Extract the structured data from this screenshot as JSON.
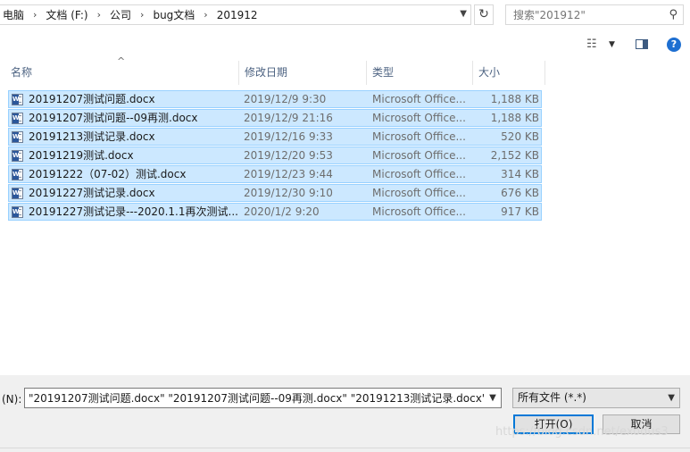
{
  "address_bar": {
    "breadcrumbs": [
      "电脑",
      "文档 (F:)",
      "公司",
      "bug文档",
      "201912"
    ],
    "separator": "›"
  },
  "search": {
    "placeholder": "搜索\"201912\""
  },
  "columns": {
    "name": "名称",
    "date": "修改日期",
    "type": "类型",
    "size": "大小"
  },
  "files": [
    {
      "name": "20191207测试问题.docx",
      "date": "2019/12/9 9:30",
      "type": "Microsoft Office...",
      "size": "1,188 KB"
    },
    {
      "name": "20191207测试问题--09再测.docx",
      "date": "2019/12/9 21:16",
      "type": "Microsoft Office...",
      "size": "1,188 KB"
    },
    {
      "name": "20191213测试记录.docx",
      "date": "2019/12/16 9:33",
      "type": "Microsoft Office...",
      "size": "520 KB"
    },
    {
      "name": "20191219测试.docx",
      "date": "2019/12/20 9:53",
      "type": "Microsoft Office...",
      "size": "2,152 KB"
    },
    {
      "name": "20191222（07-02）测试.docx",
      "date": "2019/12/23 9:44",
      "type": "Microsoft Office...",
      "size": "314 KB"
    },
    {
      "name": "20191227测试记录.docx",
      "date": "2019/12/30 9:10",
      "type": "Microsoft Office...",
      "size": "676 KB"
    },
    {
      "name": "20191227测试记录---2020.1.1再次测试...",
      "date": "2020/1/2 9:20",
      "type": "Microsoft Office...",
      "size": "917 KB"
    }
  ],
  "bottom": {
    "filename_label": "(N):",
    "filename_value": "\"20191207测试问题.docx\" \"20191207测试问题--09再测.docx\" \"20191213测试记录.docx\" \"20191219测试.docx\"",
    "filter_label": "所有文件 (*.*)",
    "open_label": "打开(O)",
    "cancel_label": "取消"
  },
  "watermark": "https://blog.csdn.net/exodus3",
  "colors": {
    "selection": "#cce8ff",
    "selection_border": "#99d1ff",
    "accent": "#0078d7"
  },
  "icons": [
    "chevron-right-icon",
    "dropdown-arrow-icon",
    "refresh-icon",
    "search-icon",
    "view-options-icon",
    "preview-pane-icon",
    "help-icon",
    "word-document-icon",
    "sort-ascending-icon"
  ]
}
